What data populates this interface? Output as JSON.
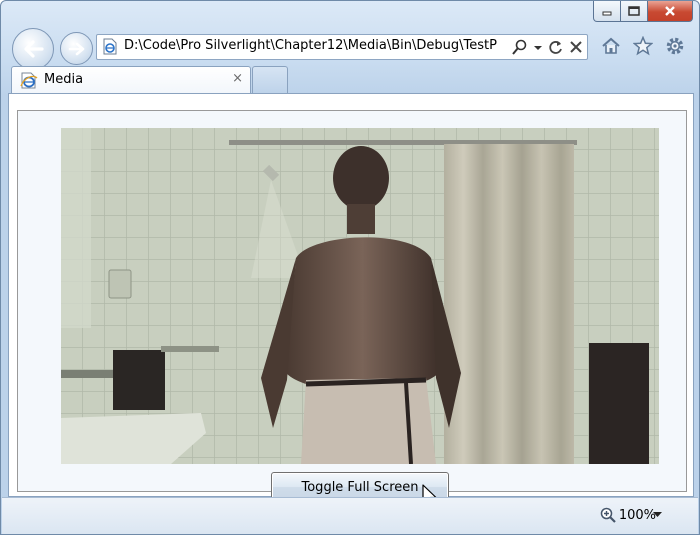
{
  "window": {
    "caption_buttons": [
      "minimize-icon",
      "maximize-icon",
      "close-icon"
    ]
  },
  "nav": {
    "back_icon": "back-arrow-icon",
    "forward_icon": "forward-arrow-icon"
  },
  "address_bar": {
    "url": "D:\\Code\\Pro Silverlight\\Chapter12\\Media\\Bin\\Debug\\TestP",
    "tools": [
      "search-icon",
      "dropdown-icon",
      "refresh-icon",
      "stop-icon"
    ]
  },
  "toolbar_icons": [
    "home-icon",
    "favorites-star-icon",
    "gear-icon"
  ],
  "tab": {
    "label": "Media",
    "close": "×"
  },
  "page": {
    "toggle_button_label": "Toggle Full Screen"
  },
  "status_bar": {
    "zoom": "100%"
  },
  "colors": {
    "chrome": "#c9dcf0",
    "close_button": "#c84a32",
    "page_bg": "#f4f8fc"
  }
}
